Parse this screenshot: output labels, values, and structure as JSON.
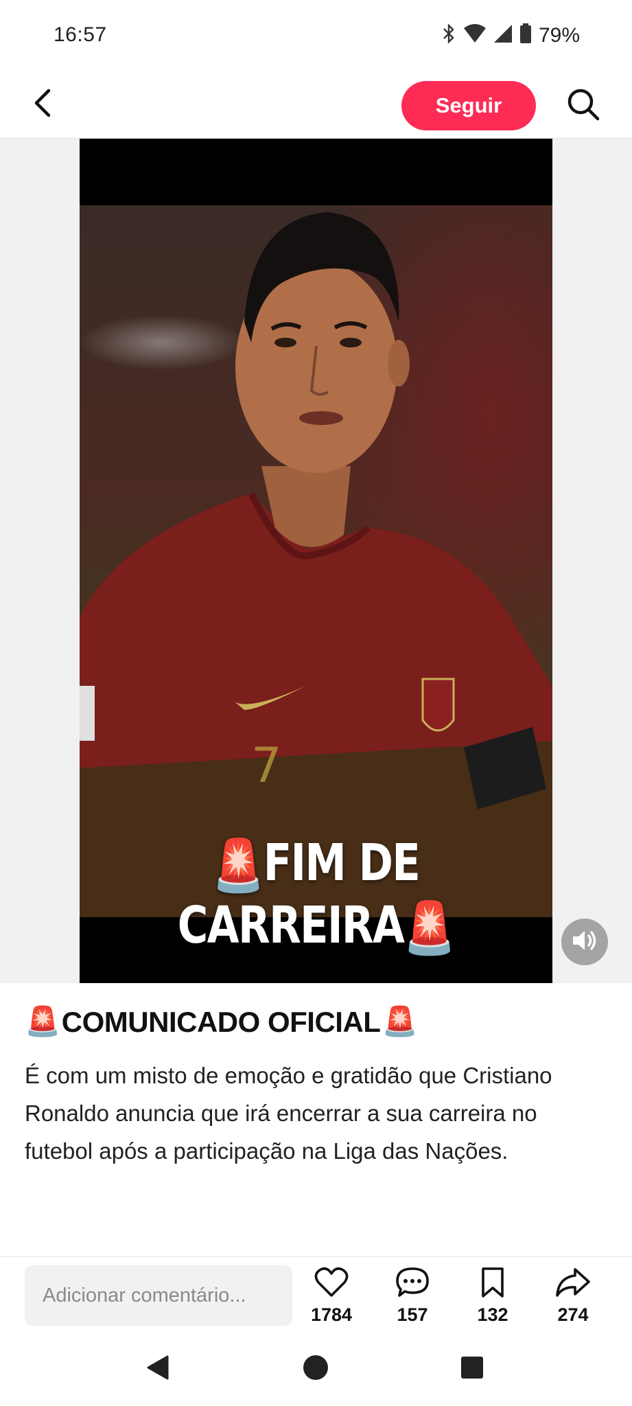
{
  "status_bar": {
    "time": "16:57",
    "battery_percent": "79%",
    "icons": [
      "bluetooth-icon",
      "wifi-icon",
      "cell-signal-icon",
      "battery-icon"
    ]
  },
  "top_nav": {
    "follow_label": "Seguir",
    "icons": [
      "back-arrow-icon",
      "search-icon"
    ]
  },
  "media": {
    "overlay_text": "FIM DE CARREIRA",
    "overlay_emoji": "🚨",
    "sound_icon": "speaker-icon"
  },
  "caption": {
    "title": "COMUNICADO OFICIAL",
    "title_emoji": "🚨",
    "body": "É com um misto de emoção e gratidão que Cristiano Ronaldo anuncia que irá encerrar a sua carreira no futebol após a participação na Liga das Nações."
  },
  "comment_bar": {
    "placeholder": "Adicionar comentário...",
    "likes": "1784",
    "comments": "157",
    "saves": "132",
    "shares": "274"
  },
  "colors": {
    "accent": "#fe2c55",
    "media_background": "#000000",
    "side_background": "#f1f1f1"
  }
}
